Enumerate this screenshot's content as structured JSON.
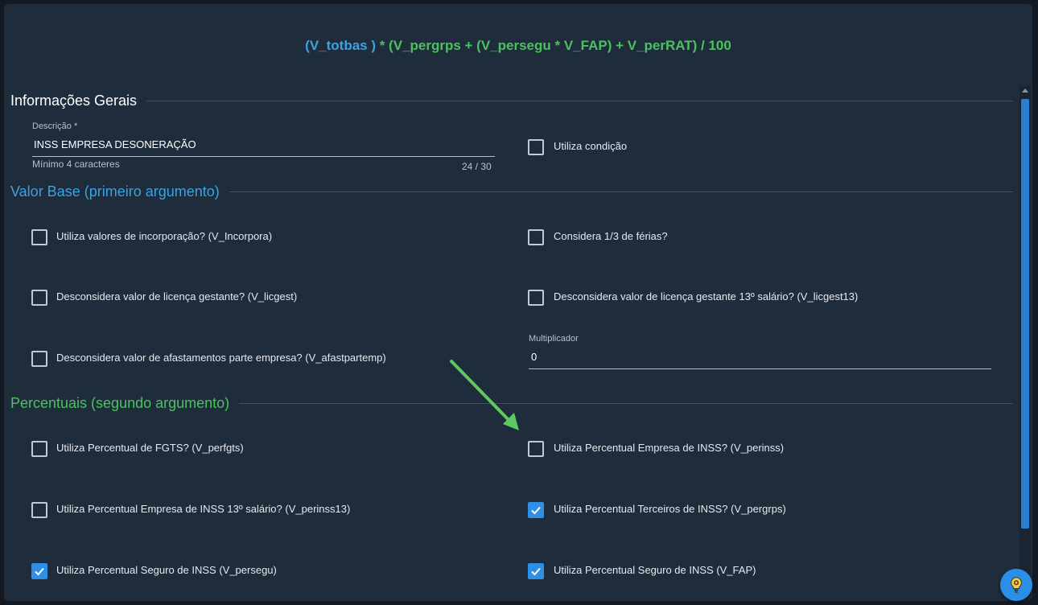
{
  "formula": {
    "part_blue": "(V_totbas )",
    "part_green": " * (V_pergrps + (V_persegu * V_FAP) + V_perRAT) / 100"
  },
  "sections": {
    "general": {
      "title": "Informações Gerais",
      "color": "#ffffff"
    },
    "base": {
      "title": "Valor Base (primeiro argumento)",
      "color": "#3aa3e0"
    },
    "percent": {
      "title": "Percentuais (segundo argumento)",
      "color": "#4cc15f"
    }
  },
  "descricao": {
    "label": "Descrição *",
    "value": "INSS EMPRESA DESONERAÇÃO",
    "hint": "Mínimo 4 caracteres",
    "counter": "24 / 30"
  },
  "utiliza_condicao": {
    "label": "Utiliza condição",
    "checked": false
  },
  "base_options": [
    {
      "label": "Utiliza valores de incorporação? (V_Incorpora)",
      "checked": false
    },
    {
      "label": "Considera 1/3 de férias?",
      "checked": false
    },
    {
      "label": "Desconsidera valor de licença gestante? (V_licgest)",
      "checked": false
    },
    {
      "label": "Desconsidera valor de licença gestante 13º salário? (V_licgest13)",
      "checked": false
    },
    {
      "label": "Desconsidera valor de afastamentos parte empresa? (V_afastpartemp)",
      "checked": false
    }
  ],
  "multiplicador": {
    "label": "Multiplicador",
    "value": "0"
  },
  "percent_options": [
    {
      "label": "Utiliza Percentual de FGTS? (V_perfgts)",
      "checked": false
    },
    {
      "label": "Utiliza Percentual Empresa de INSS? (V_perinss)",
      "checked": false
    },
    {
      "label": "Utiliza Percentual Empresa de INSS 13º salário? (V_perinss13)",
      "checked": false
    },
    {
      "label": "Utiliza Percentual Terceiros de INSS? (V_pergrps)",
      "checked": true
    },
    {
      "label": "Utiliza Percentual Seguro de INSS (V_persegu)",
      "checked": true
    },
    {
      "label": "Utiliza Percentual Seguro de INSS (V_FAP)",
      "checked": true
    }
  ],
  "colors": {
    "accent": "#2e8fe6",
    "arrow": "#5ec95f"
  },
  "fab_icon": "lightbulb-gear-icon"
}
